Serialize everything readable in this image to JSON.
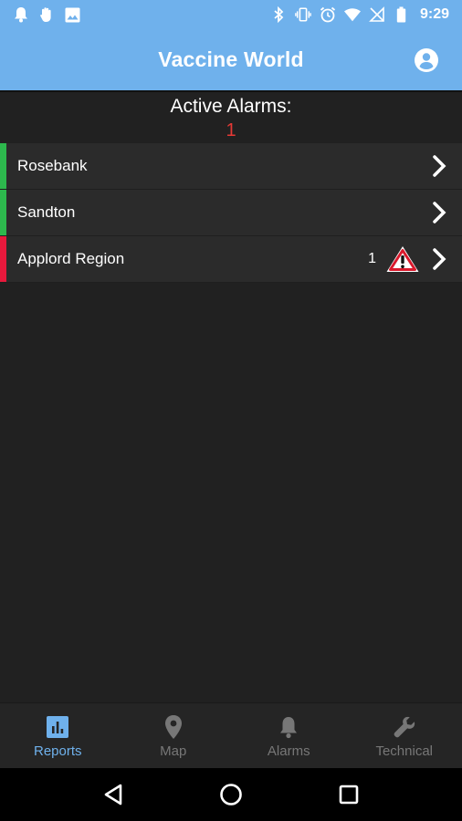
{
  "status_bar": {
    "time": "9:29",
    "left_icons": [
      "notification-bell-icon",
      "hand-icon",
      "image-icon"
    ],
    "right_icons": [
      "bluetooth-icon",
      "vibrate-icon",
      "alarm-clock-icon",
      "wifi-icon",
      "no-signal-icon",
      "battery-icon"
    ]
  },
  "app_bar": {
    "title": "Vaccine World",
    "account_icon": "account-circle-icon"
  },
  "summary": {
    "label": "Active Alarms:",
    "count": "1",
    "count_color": "#e53935"
  },
  "regions": [
    {
      "name": "Rosebank",
      "status": "ok",
      "strip_color": "#2db84d",
      "alarm_count": ""
    },
    {
      "name": "Sandton",
      "status": "ok",
      "strip_color": "#2db84d",
      "alarm_count": ""
    },
    {
      "name": "Applord Region",
      "status": "alarm",
      "strip_color": "#e8193c",
      "alarm_count": "1",
      "warning_icon": "warning-triangle-icon"
    }
  ],
  "bottom_nav": {
    "items": [
      {
        "label": "Reports",
        "icon": "bar-chart-icon",
        "active": true
      },
      {
        "label": "Map",
        "icon": "location-pin-icon",
        "active": false
      },
      {
        "label": "Alarms",
        "icon": "bell-icon",
        "active": false
      },
      {
        "label": "Technical",
        "icon": "wrench-icon",
        "active": false
      }
    ]
  },
  "colors": {
    "accent": "#6fb1ec",
    "background": "#212121",
    "row_background": "#2b2b2b",
    "inactive_nav": "#777777"
  }
}
